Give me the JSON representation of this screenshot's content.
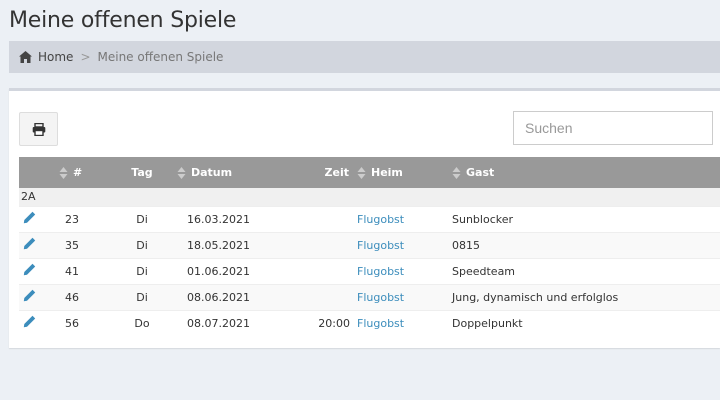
{
  "page": {
    "title": "Meine offenen Spiele"
  },
  "breadcrumb": {
    "home": "Home",
    "separator": ">",
    "current": "Meine offenen Spiele"
  },
  "toolbar": {
    "print_icon": "print-icon",
    "search_placeholder": "Suchen"
  },
  "table": {
    "headers": {
      "num": "#",
      "tag": "Tag",
      "datum": "Datum",
      "zeit": "Zeit",
      "heim": "Heim",
      "gast": "Gast"
    },
    "group": "2A",
    "rows": [
      {
        "num": "23",
        "tag": "Di",
        "datum": "16.03.2021",
        "zeit": "",
        "heim": "Flugobst",
        "gast": "Sunblocker"
      },
      {
        "num": "35",
        "tag": "Di",
        "datum": "18.05.2021",
        "zeit": "",
        "heim": "Flugobst",
        "gast": "0815"
      },
      {
        "num": "41",
        "tag": "Di",
        "datum": "01.06.2021",
        "zeit": "",
        "heim": "Flugobst",
        "gast": "Speedteam"
      },
      {
        "num": "46",
        "tag": "Di",
        "datum": "08.06.2021",
        "zeit": "",
        "heim": "Flugobst",
        "gast": "Jung, dynamisch und erfolglos"
      },
      {
        "num": "56",
        "tag": "Do",
        "datum": "08.07.2021",
        "zeit": "20:00",
        "heim": "Flugobst",
        "gast": "Doppelpunkt"
      }
    ]
  },
  "colors": {
    "link": "#3c8dbc",
    "header_bg": "#999999",
    "breadcrumb_bg": "#d2d6de",
    "edit_icon": "#3c8dbc"
  }
}
